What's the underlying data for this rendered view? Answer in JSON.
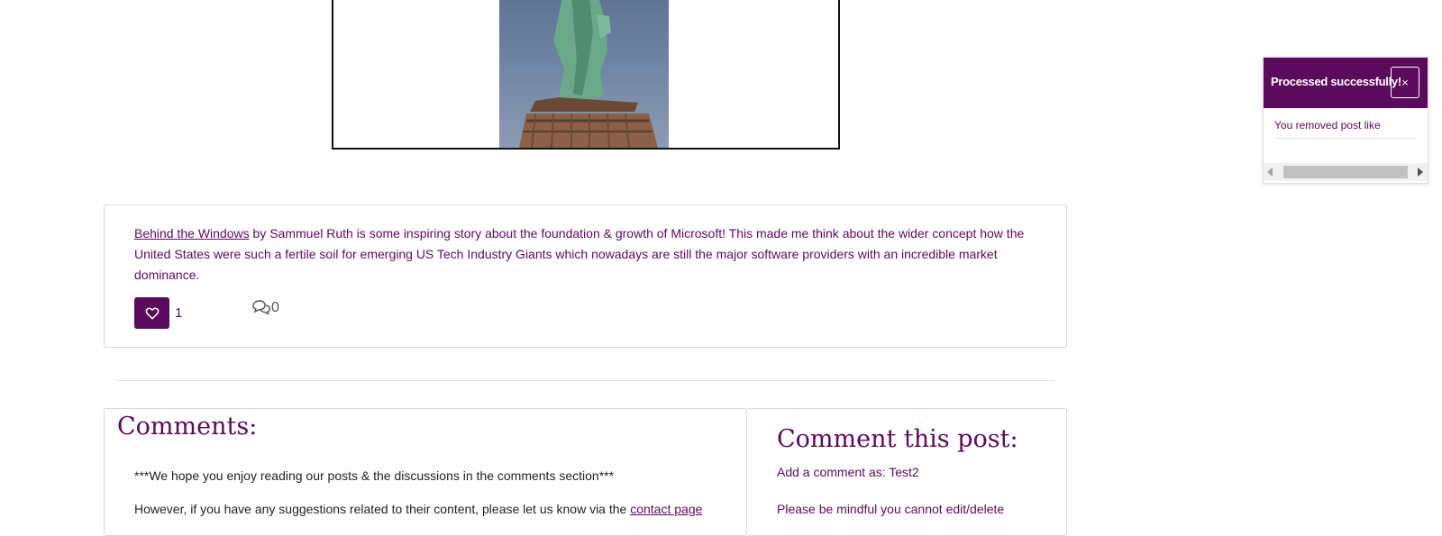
{
  "post": {
    "link_text": "Behind the Windows",
    "text": " by Sammuel Ruth is some inspiring story about the foundation & growth of Microsoft! This made me think about the wider concept how the United States were such a fertile soil for emerging US Tech Industry Giants which nowadays are still the major software providers with an incredible market dominance.",
    "like_count": "1",
    "comment_count": "0"
  },
  "comments": {
    "title": "Comments:",
    "note": "***We hope you enjoy reading our posts & the discussions in the comments section***",
    "suggest_text": "However, if you have any suggestions related to their content, please let us know via the ",
    "contact_link": "contact page"
  },
  "comment_form": {
    "title": "Comment this post:",
    "add_as": "Add a comment as: Test2",
    "mindful": "Please be mindful you cannot edit/delete"
  },
  "toast": {
    "title": "Processed successfully!",
    "close": "×",
    "message": "You removed post like"
  },
  "colors": {
    "brand": "#5c0a5c"
  },
  "icons": {
    "like": "heart-icon",
    "comment": "comment-bubbles-icon",
    "close": "close-icon"
  }
}
